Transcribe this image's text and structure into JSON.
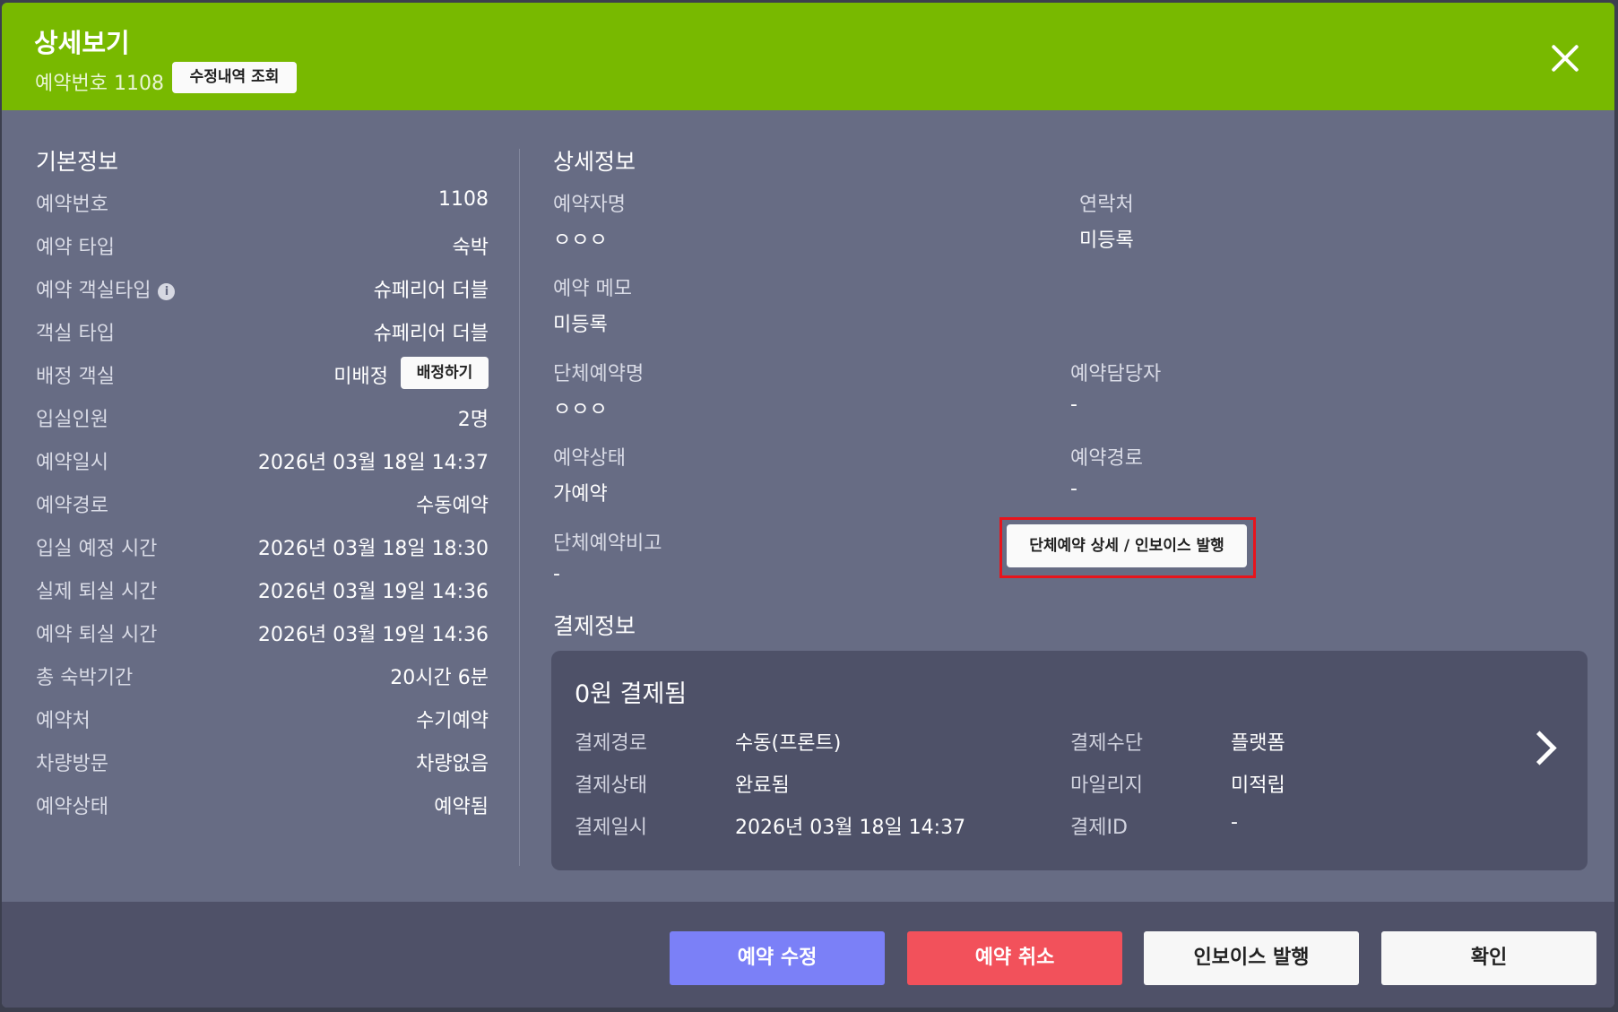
{
  "header": {
    "title": "상세보기",
    "reservation_number": "예약번호 1108",
    "history_button": "수정내역 조회"
  },
  "basic_info": {
    "title": "기본정보",
    "rows": [
      {
        "label": "예약번호",
        "value": "1108"
      },
      {
        "label": "예약 타입",
        "value": "숙박"
      },
      {
        "label": "예약 객실타입",
        "value": "슈페리어 더블"
      },
      {
        "label": "객실 타입",
        "value": "슈페리어 더블"
      },
      {
        "label": "배정 객실",
        "value": "미배정",
        "button": "배정하기"
      },
      {
        "label": "입실인원",
        "value": "2명"
      },
      {
        "label": "예약일시",
        "value": "2026년 03월 18일 14:37"
      },
      {
        "label": "예약경로",
        "value": "수동예약"
      },
      {
        "label": "입실 예정 시간",
        "value": "2026년 03월 18일 18:30"
      },
      {
        "label": "실제 퇴실 시간",
        "value": "2026년 03월 19일 14:36"
      },
      {
        "label": "예약 퇴실 시간",
        "value": "2026년 03월 19일 14:36"
      },
      {
        "label": "총 숙박기간",
        "value": "20시간 6분"
      },
      {
        "label": "예약처",
        "value": "수기예약"
      },
      {
        "label": "차량방문",
        "value": "차량없음"
      },
      {
        "label": "예약상태",
        "value": "예약됨"
      }
    ],
    "info_icon": "i"
  },
  "detail_info": {
    "title": "상세정보",
    "booker_name": {
      "label": "예약자명",
      "value": "ㅇㅇㅇ"
    },
    "contact": {
      "label": "연락처",
      "value": "미등록"
    },
    "memo": {
      "label": "예약 메모",
      "value": "미등록"
    },
    "group_name": {
      "label": "단체예약명",
      "value": "ㅇㅇㅇ"
    },
    "manager": {
      "label": "예약담당자",
      "value": "-"
    },
    "status": {
      "label": "예약상태",
      "value": "가예약"
    },
    "route": {
      "label": "예약경로",
      "value": "-"
    },
    "group_note": {
      "label": "단체예약비고",
      "value": "-"
    },
    "group_button": "단체예약 상세 / 인보이스 발행"
  },
  "payment_info": {
    "title": "결제정보",
    "card_title": "0원 결제됨",
    "route_label": "결제경로",
    "route_value": "수동(프론트)",
    "method_label": "결제수단",
    "method_value": "플랫폼",
    "status_label": "결제상태",
    "status_value": "완료됨",
    "mileage_label": "마일리지",
    "mileage_value": "미적립",
    "date_label": "결제일시",
    "date_value": "2026년 03월 18일 14:37",
    "id_label": "결제ID",
    "id_value": "-"
  },
  "footer": {
    "edit": "예약 수정",
    "cancel": "예약 취소",
    "invoice": "인보이스 발행",
    "ok": "확인"
  },
  "colors": {
    "header": "#78b900",
    "body": "#676c84",
    "edit_button": "#7b80f7",
    "cancel_button": "#f2515b",
    "highlight": "#e8141c"
  }
}
